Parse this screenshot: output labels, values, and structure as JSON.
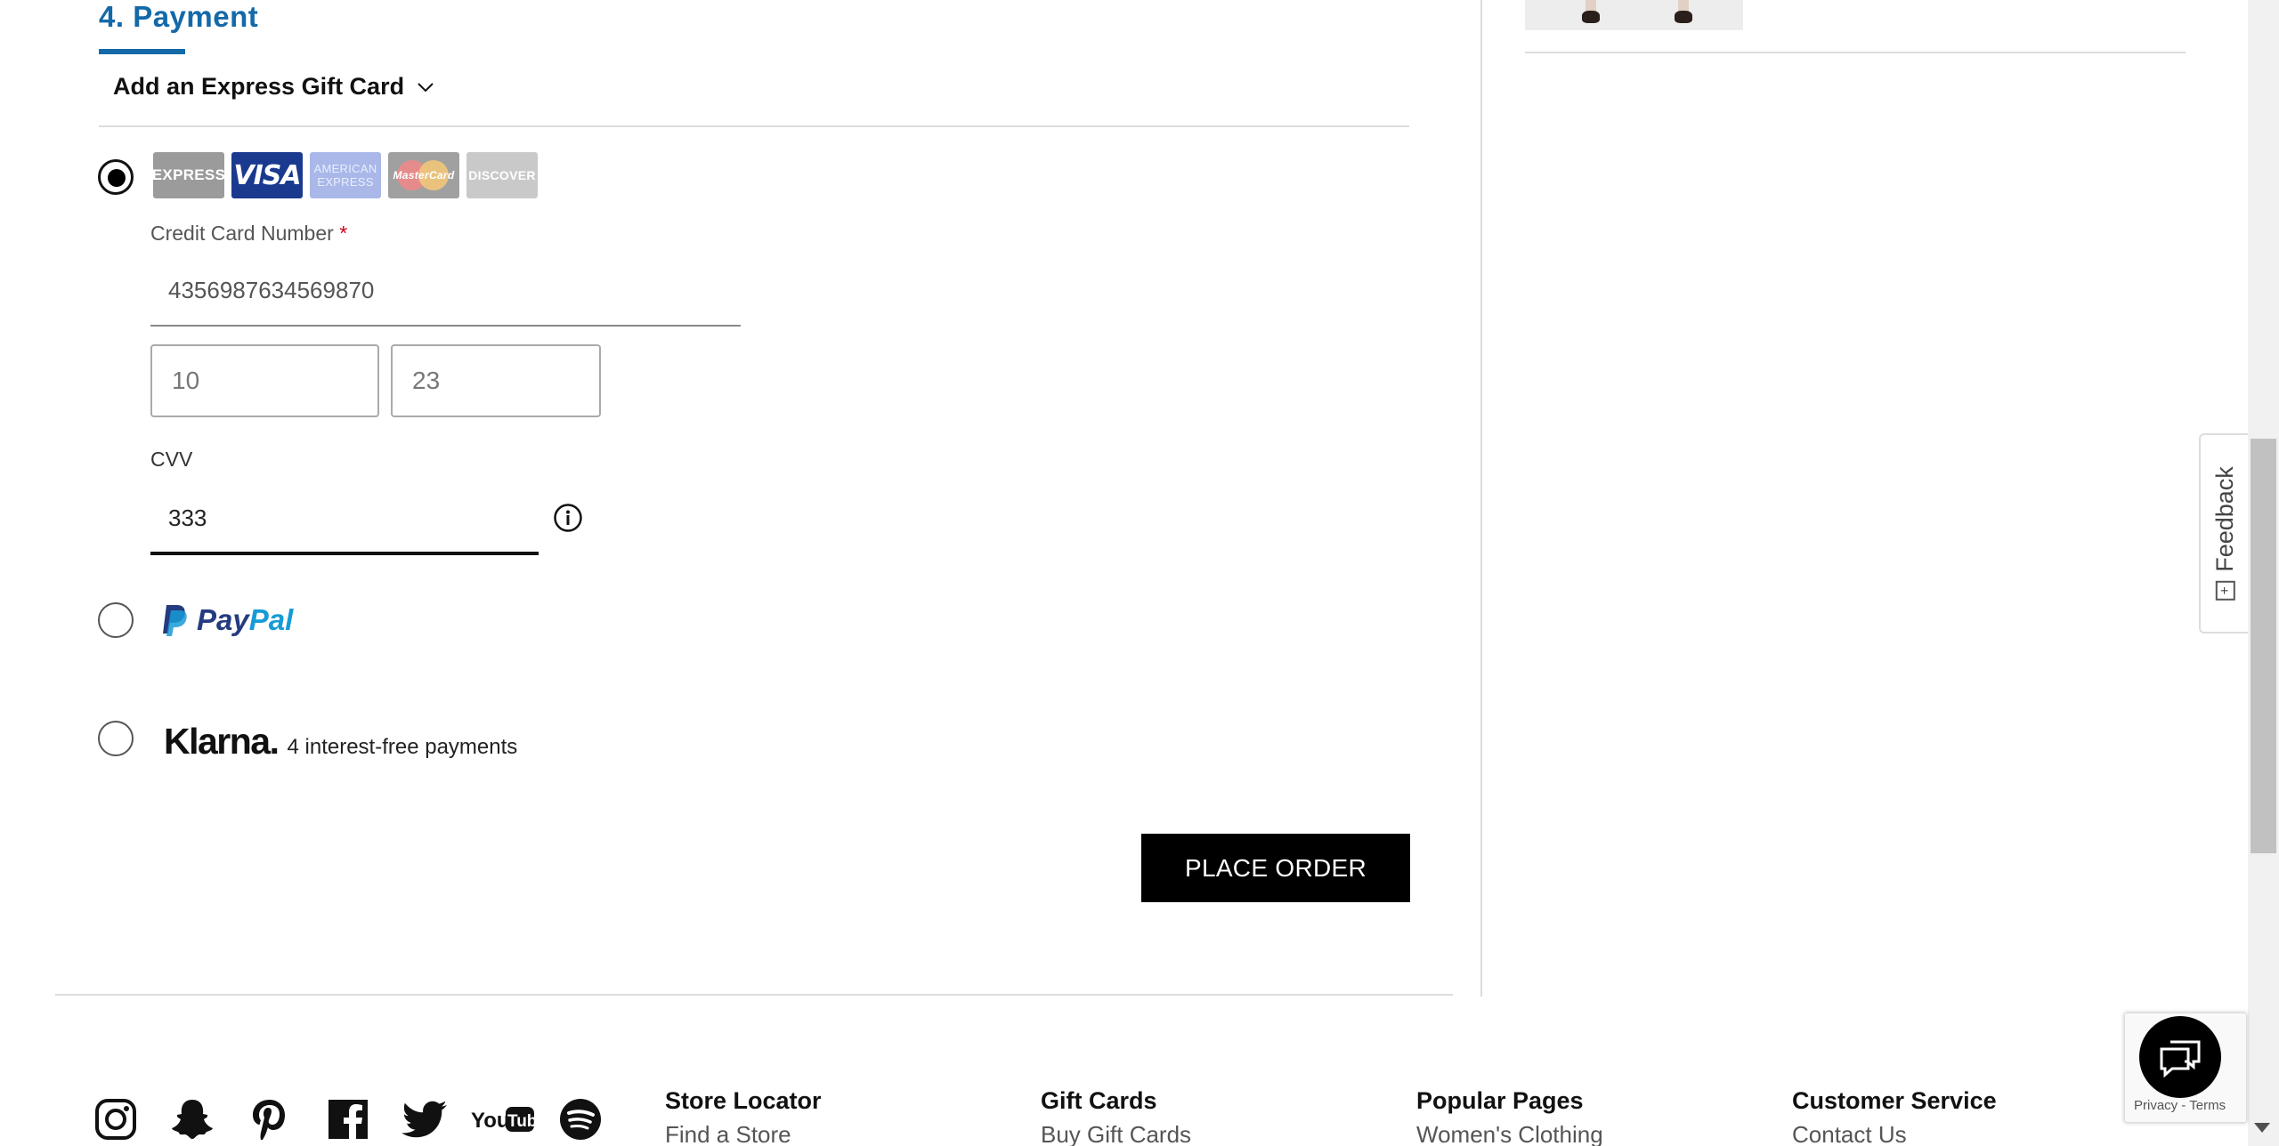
{
  "payment": {
    "section_title": "4. Payment",
    "gift_card_label": "Add an Express Gift Card",
    "card_brands": {
      "express": "EXPRESS",
      "visa": "VISA",
      "amex_line1": "AMERICAN",
      "amex_line2": "EXPRESS",
      "mastercard": "MasterCard",
      "discover": "DISCOVER"
    },
    "credit_card_label": "Credit Card Number",
    "required_marker": "*",
    "credit_card_value": "4356987634569870",
    "exp_month_value": "10",
    "exp_year_value": "23",
    "cvv_label": "CVV",
    "cvv_value": "333",
    "paypal": {
      "word1": "Pay",
      "word2": "Pal"
    },
    "klarna": {
      "brand": "Klarna.",
      "text": "4 interest-free payments"
    },
    "place_order_label": "PLACE ORDER",
    "selected_method": "credit-card"
  },
  "feedback": {
    "label": "Feedback",
    "icon_text": "+"
  },
  "recaptcha": {
    "text": "Privacy - Terms"
  },
  "footer": {
    "social_icons": [
      "instagram-icon",
      "snapchat-icon",
      "pinterest-icon",
      "facebook-icon",
      "twitter-icon",
      "youtube-icon",
      "spotify-icon"
    ],
    "columns": [
      {
        "title": "Store Locator",
        "link": "Find a Store"
      },
      {
        "title": "Gift Cards",
        "link": "Buy Gift Cards"
      },
      {
        "title": "Popular Pages",
        "link": "Women's Clothing"
      },
      {
        "title": "Customer Service",
        "link": "Contact Us"
      }
    ]
  },
  "colors": {
    "accent": "#1469a8",
    "button_bg": "#000000",
    "paypal_dark": "#253b80",
    "paypal_light": "#179bd7"
  }
}
